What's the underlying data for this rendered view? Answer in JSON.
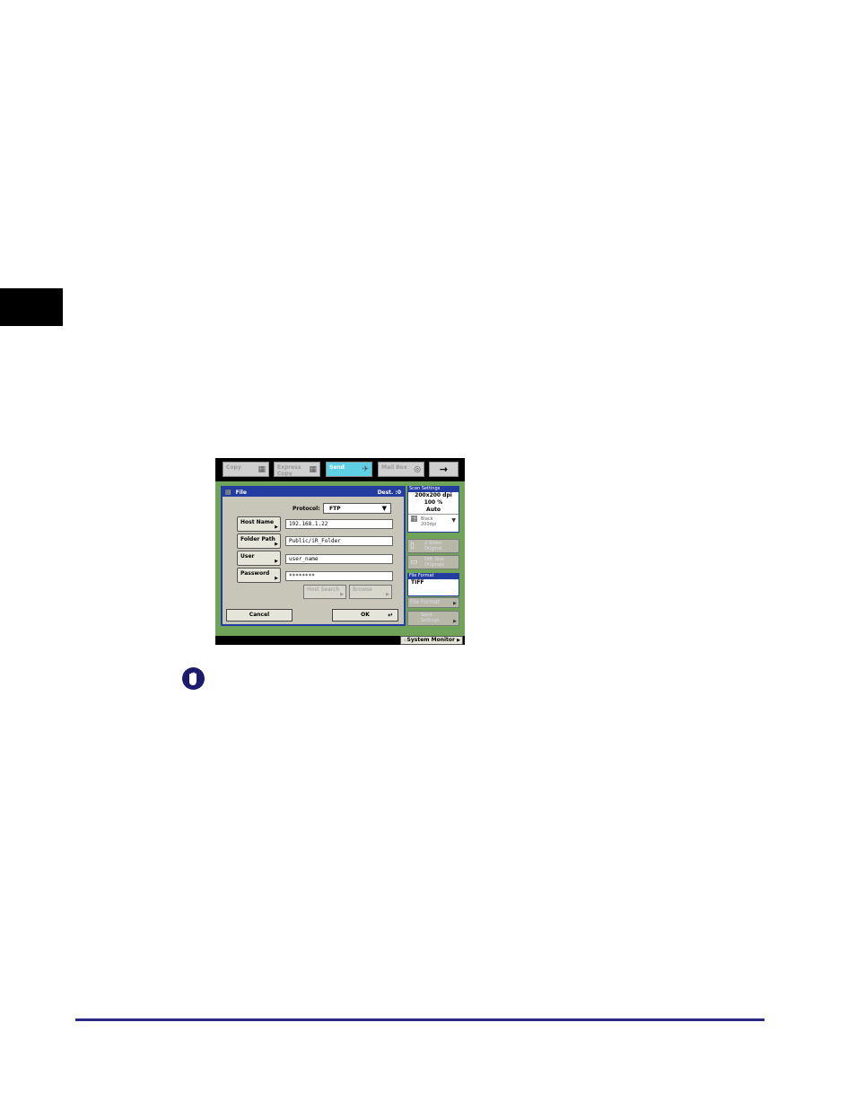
{
  "tabs": [
    {
      "label": "Copy"
    },
    {
      "label": "Express Copy"
    },
    {
      "label": "Send"
    },
    {
      "label": "Mail Box"
    },
    {
      "label": "→"
    }
  ],
  "panel": {
    "title": "File",
    "dest": "Dest. :0"
  },
  "protocol": {
    "label": "Protocol:",
    "value": "FTP"
  },
  "fields": {
    "host_name": {
      "label": "Host Name",
      "value": "192.168.1.22"
    },
    "folder_path": {
      "label": "Folder Path",
      "value": "Public/iR_Folder"
    },
    "user": {
      "label": "User",
      "value": "user_name"
    },
    "password": {
      "label": "Password",
      "value": "********"
    }
  },
  "search_buttons": {
    "host_search": "Host Search",
    "browse": "Browse"
  },
  "actions": {
    "cancel": "Cancel",
    "ok": "OK"
  },
  "scan_settings": {
    "title": "Scan Settings",
    "resolution": "200x200 dpi",
    "ratio": "100 %",
    "size": "Auto",
    "mode_line1": "Black",
    "mode_line2": "200dpi"
  },
  "side_buttons": {
    "two_sided_line1": "2-Sided",
    "two_sided_line2": "Original",
    "diff_size_line1": "Diff. Size",
    "diff_size_line2": "Originals"
  },
  "file_format": {
    "title": "File Format",
    "value": "TIFF",
    "button": "File Format"
  },
  "send_settings": {
    "line1": "Send",
    "line2": "Settings"
  },
  "system_monitor": "System Monitor"
}
